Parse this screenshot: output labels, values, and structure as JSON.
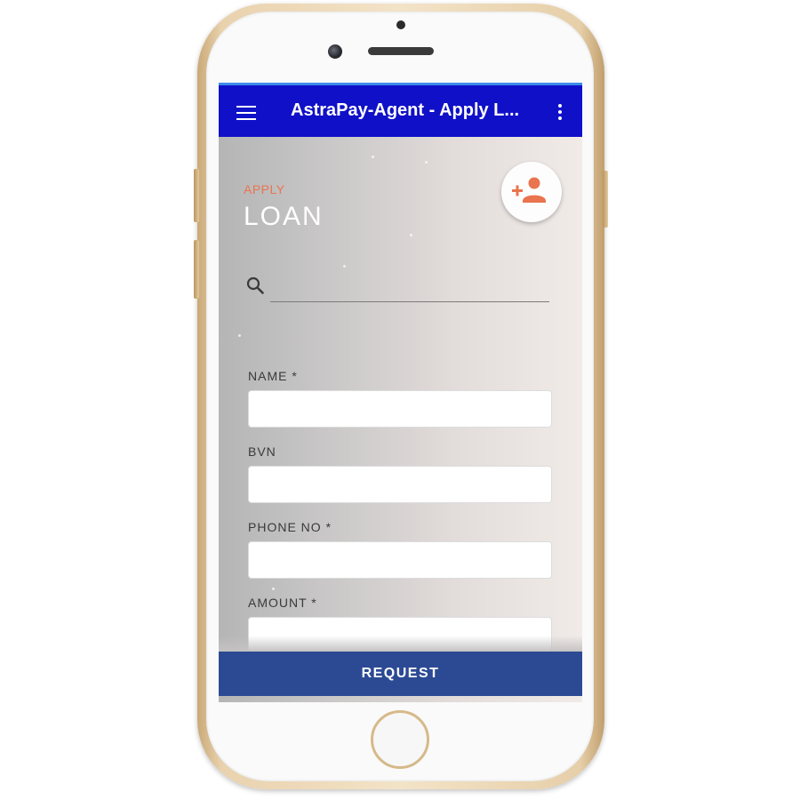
{
  "app_bar": {
    "title": "AstraPay-Agent - Apply L...",
    "menu_icon": "hamburger-menu-icon",
    "overflow_icon": "more-vertical-icon",
    "color": "#1010c8"
  },
  "header": {
    "kicker": "APPLY",
    "title": "LOAN",
    "kicker_color": "#e9744f"
  },
  "add_person": {
    "icon": "add-person-icon",
    "color": "#e9744f"
  },
  "search": {
    "icon": "search-icon",
    "value": "",
    "placeholder": ""
  },
  "form": {
    "fields": [
      {
        "label": "NAME *",
        "value": ""
      },
      {
        "label": "BVN",
        "value": ""
      },
      {
        "label": "PHONE NO *",
        "value": ""
      },
      {
        "label": "AMOUNT *",
        "value": ""
      }
    ]
  },
  "actions": {
    "request_label": "REQUEST",
    "request_color": "#2c4a94"
  }
}
